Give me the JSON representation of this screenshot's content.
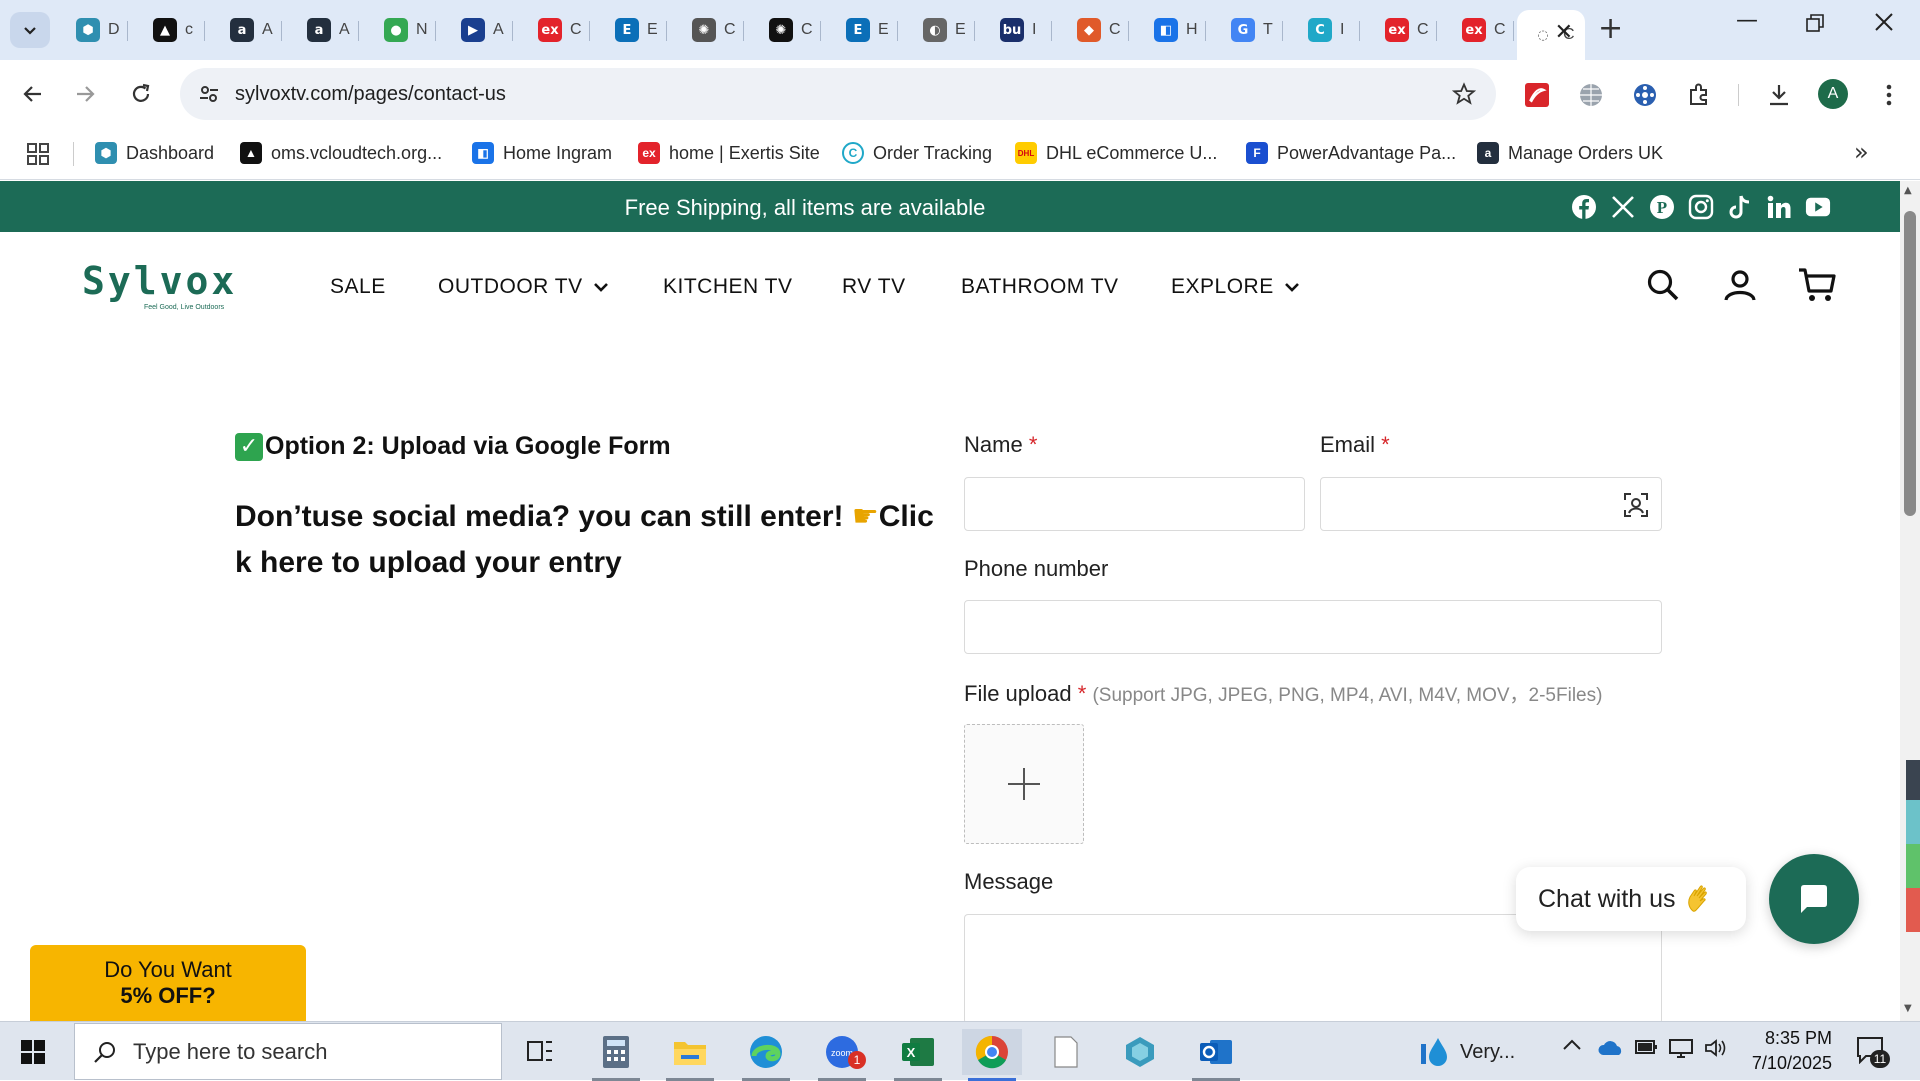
{
  "browser": {
    "tabs": [
      {
        "title": "D",
        "icon": "hex-icon",
        "color": "#2f8fb0"
      },
      {
        "title": "c",
        "icon": "triangle-icon",
        "color": "#111111"
      },
      {
        "title": "A",
        "icon": "amazon-icon",
        "color": "#232f3e"
      },
      {
        "title": "A",
        "icon": "amazon-icon",
        "color": "#232f3e"
      },
      {
        "title": "N",
        "icon": "leaf-icon",
        "color": "#34a853"
      },
      {
        "title": "A",
        "icon": "arrow-icon",
        "color": "#1a3f8f"
      },
      {
        "title": "C",
        "icon": "exertis-icon",
        "color": "#e3232b"
      },
      {
        "title": "E",
        "icon": "e-icon",
        "color": "#0b6fb8"
      },
      {
        "title": "C",
        "icon": "openai-icon",
        "color": "#555555"
      },
      {
        "title": "C",
        "icon": "openai-icon",
        "color": "#111111"
      },
      {
        "title": "E",
        "icon": "e-icon",
        "color": "#0b6fb8"
      },
      {
        "title": "E",
        "icon": "bulb-icon",
        "color": "#666666"
      },
      {
        "title": "I",
        "icon": "bu-icon",
        "color": "#1a2f6b"
      },
      {
        "title": "C",
        "icon": "stack-icon",
        "color": "#e05a2a"
      },
      {
        "title": "H",
        "icon": "ingram-icon",
        "color": "#1a73e8"
      },
      {
        "title": "T",
        "icon": "google-icon",
        "color": "#4285f4"
      },
      {
        "title": "I",
        "icon": "c-icon",
        "color": "#20a8c8"
      },
      {
        "title": "C",
        "icon": "exertis-icon",
        "color": "#e3232b"
      },
      {
        "title": "C",
        "icon": "exertis-icon",
        "color": "#e3232b"
      },
      {
        "title": "C",
        "icon": "loading-icon",
        "color": "#666666",
        "active": true
      }
    ],
    "url": "sylvoxtv.com/pages/contact-us",
    "profile_initial": "A",
    "bookmarks": [
      {
        "label": "Dashboard",
        "icon": "hex-icon",
        "color": "#2f8fb0"
      },
      {
        "label": "oms.vcloudtech.org...",
        "icon": "triangle-icon",
        "color": "#111111"
      },
      {
        "label": "Home Ingram",
        "icon": "ingram-icon",
        "color": "#1a73e8"
      },
      {
        "label": "home | Exertis Site",
        "icon": "exertis-icon",
        "color": "#e3232b"
      },
      {
        "label": "Order Tracking",
        "icon": "c-icon",
        "color": "#20a8c8"
      },
      {
        "label": "DHL eCommerce U...",
        "icon": "dhl-icon",
        "color": "#ffcc00"
      },
      {
        "label": "PowerAdvantage Pa...",
        "icon": "pa-icon",
        "color": "#1a4fd0"
      },
      {
        "label": "Manage Orders UK",
        "icon": "amazon-icon",
        "color": "#232f3e"
      }
    ]
  },
  "site": {
    "announcement": "Free Shipping, all items are available",
    "brand_color": "#1c6b56",
    "logo_text": "Sylvox",
    "logo_tagline": "Feel Good, Live Outdoors",
    "nav": {
      "sale": "SALE",
      "outdoor": "OUTDOOR TV",
      "kitchen": "KITCHEN TV",
      "rv": "RV TV",
      "bathroom": "BATHROOM TV",
      "explore": "EXPLORE"
    }
  },
  "content": {
    "option_title": "Option 2: Upload via Google Form",
    "promo_part1": "Don’tuse social media? you can still enter! ",
    "promo_part2": "Click here to upload your entry"
  },
  "form": {
    "name_label": "Name",
    "email_label": "Email",
    "phone_label": "Phone number",
    "file_label": "File upload",
    "file_hint": "(Support JPG, JPEG, PNG, MP4, AVI, M4V, MOV，2-5Files)",
    "message_label": "Message",
    "required_mark": "*",
    "name_value": "",
    "email_value": "",
    "phone_value": "",
    "message_value": ""
  },
  "widgets": {
    "chat_label": "Chat with us",
    "discount_line1": "Do You Want",
    "discount_line2": "5% OFF?"
  },
  "taskbar": {
    "search_placeholder": "Type here to search",
    "weather": "Very...",
    "time": "8:35 PM",
    "date": "7/10/2025",
    "notification_count": "11",
    "zoom_badge": "1"
  }
}
